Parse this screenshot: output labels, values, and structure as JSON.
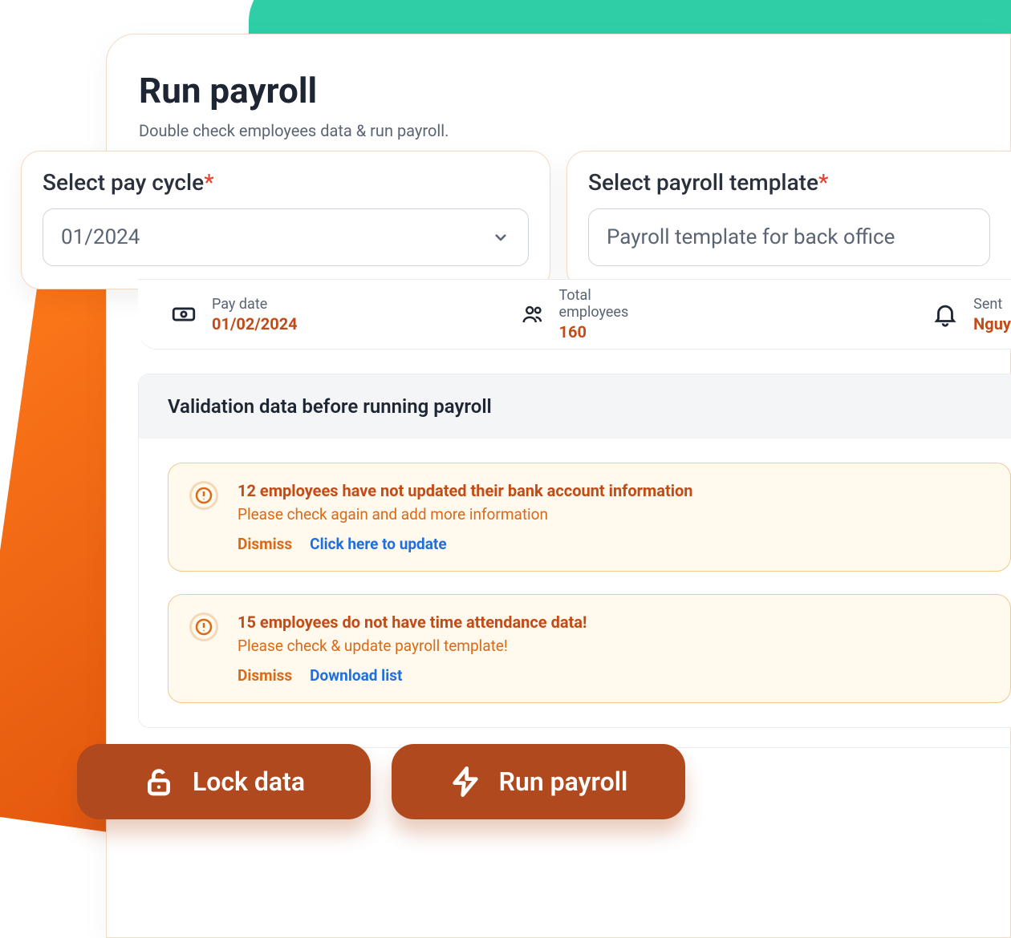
{
  "page": {
    "title": "Run payroll",
    "subtitle": "Double check employees data & run payroll."
  },
  "selectors": {
    "pay_cycle": {
      "label": "Select pay cycle",
      "value": "01/2024"
    },
    "template": {
      "label": "Select payroll template",
      "value": "Payroll template for back office"
    }
  },
  "info": {
    "pay_date": {
      "label": "Pay date",
      "value": "01/02/2024"
    },
    "total_employees": {
      "label": "Total employees",
      "value": "160"
    },
    "sent": {
      "label": "Sent",
      "value": "Nguy"
    }
  },
  "validation": {
    "heading": "Validation data before running payroll",
    "alerts": [
      {
        "title": "12 employees have not updated their bank account information",
        "message": "Please check again and add more information",
        "dismiss_label": "Dismiss",
        "action_label": "Click here to update"
      },
      {
        "title": "15 employees do not have time attendance data!",
        "message": "Please check & update payroll template!",
        "dismiss_label": "Dismiss",
        "action_label": "Download list"
      }
    ]
  },
  "buttons": {
    "lock": "Lock data",
    "run": "Run payroll"
  },
  "required_marker": "*"
}
